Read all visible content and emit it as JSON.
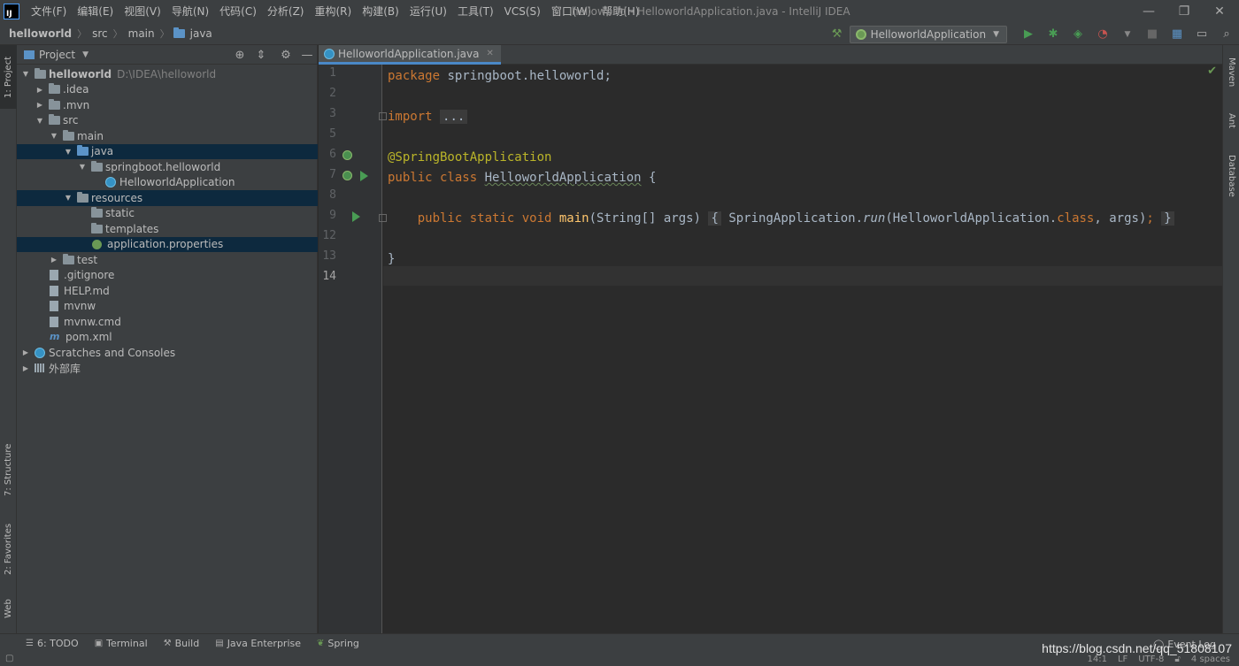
{
  "menu": [
    "文件(F)",
    "编辑(E)",
    "视图(V)",
    "导航(N)",
    "代码(C)",
    "分析(Z)",
    "重构(R)",
    "构建(B)",
    "运行(U)",
    "工具(T)",
    "VCS(S)",
    "窗口(W)",
    "帮助(H)"
  ],
  "window_title": "helloworld - HelloworldApplication.java - IntelliJ IDEA",
  "logo": "IJ",
  "breadcrumb": [
    "helloworld",
    "src",
    "main",
    "java"
  ],
  "run_config": "HelloworldApplication",
  "left_tabs": [
    "1: Project",
    "7: Structure",
    "2: Favorites",
    "Web"
  ],
  "right_tabs": [
    "Maven",
    "Ant",
    "Database"
  ],
  "project_panel": {
    "title": "Project",
    "tree": [
      {
        "label": "helloworld",
        "hint": "D:\\IDEA\\helloworld",
        "depth": 0,
        "arrow": "down",
        "icon": "module",
        "bold": true
      },
      {
        "label": ".idea",
        "depth": 1,
        "arrow": "right",
        "icon": "folder"
      },
      {
        "label": ".mvn",
        "depth": 1,
        "arrow": "right",
        "icon": "folder"
      },
      {
        "label": "src",
        "depth": 1,
        "arrow": "down",
        "icon": "folder"
      },
      {
        "label": "main",
        "depth": 2,
        "arrow": "down",
        "icon": "folder"
      },
      {
        "label": "java",
        "depth": 3,
        "arrow": "down",
        "icon": "folder-blue",
        "selected": true
      },
      {
        "label": "springboot.helloworld",
        "depth": 4,
        "arrow": "down",
        "icon": "package"
      },
      {
        "label": "HelloworldApplication",
        "depth": 5,
        "arrow": "",
        "icon": "class"
      },
      {
        "label": "resources",
        "depth": 3,
        "arrow": "down",
        "icon": "folder-res",
        "selected": true
      },
      {
        "label": "static",
        "depth": 4,
        "arrow": "",
        "icon": "folder"
      },
      {
        "label": "templates",
        "depth": 4,
        "arrow": "",
        "icon": "folder"
      },
      {
        "label": "application.properties",
        "depth": 4,
        "arrow": "",
        "icon": "leaf",
        "selected": true
      },
      {
        "label": "test",
        "depth": 2,
        "arrow": "right",
        "icon": "folder"
      },
      {
        "label": ".gitignore",
        "depth": 1,
        "arrow": "",
        "icon": "file"
      },
      {
        "label": "HELP.md",
        "depth": 1,
        "arrow": "",
        "icon": "file"
      },
      {
        "label": "mvnw",
        "depth": 1,
        "arrow": "",
        "icon": "file"
      },
      {
        "label": "mvnw.cmd",
        "depth": 1,
        "arrow": "",
        "icon": "file"
      },
      {
        "label": "pom.xml",
        "depth": 1,
        "arrow": "",
        "icon": "maven"
      },
      {
        "label": "Scratches and Consoles",
        "depth": 0,
        "arrow": "right",
        "icon": "scratch"
      },
      {
        "label": "外部库",
        "depth": 0,
        "arrow": "right",
        "icon": "library"
      }
    ]
  },
  "editor": {
    "tab": "HelloworldApplication.java",
    "lines": [
      {
        "n": "1"
      },
      {
        "n": "2"
      },
      {
        "n": "3"
      },
      {
        "n": "5"
      },
      {
        "n": "6"
      },
      {
        "n": "7"
      },
      {
        "n": "8"
      },
      {
        "n": "9"
      },
      {
        "n": "12"
      },
      {
        "n": "13"
      },
      {
        "n": "14"
      }
    ],
    "code": {
      "l1_kw": "package",
      "l1_rest": " springboot.helloworld;",
      "l3_kw": "import",
      "l3_fold": "...",
      "l6_ann": "@SpringBootApplication",
      "l7_kw": "public class",
      "l7_name": "HelloworldApplication",
      "l7_rest": " {",
      "l9_kw": "public static void",
      "l9_fn": "main",
      "l9_sig": "(String[] args) ",
      "l9_open": "{",
      "l9_call1": " SpringApplication.",
      "l9_run": "run",
      "l9_call2": "(HelloworldApplication.",
      "l9_class": "class",
      "l9_call3": ", args)",
      "l9_semi": ";",
      "l9_close": "}",
      "l13": "}"
    }
  },
  "bottom_tools": [
    {
      "icon": "todo",
      "label": "6: TODO"
    },
    {
      "icon": "terminal",
      "label": "Terminal"
    },
    {
      "icon": "hammer",
      "label": "Build"
    },
    {
      "icon": "javaee",
      "label": "Java Enterprise"
    },
    {
      "icon": "spring",
      "label": "Spring"
    }
  ],
  "event_log": "Event Log",
  "status": {
    "pos": "14:1",
    "le": "LF",
    "enc": "UTF-8",
    "indent": "4 spaces"
  },
  "watermark": "https://blog.csdn.net/qq_51808107"
}
